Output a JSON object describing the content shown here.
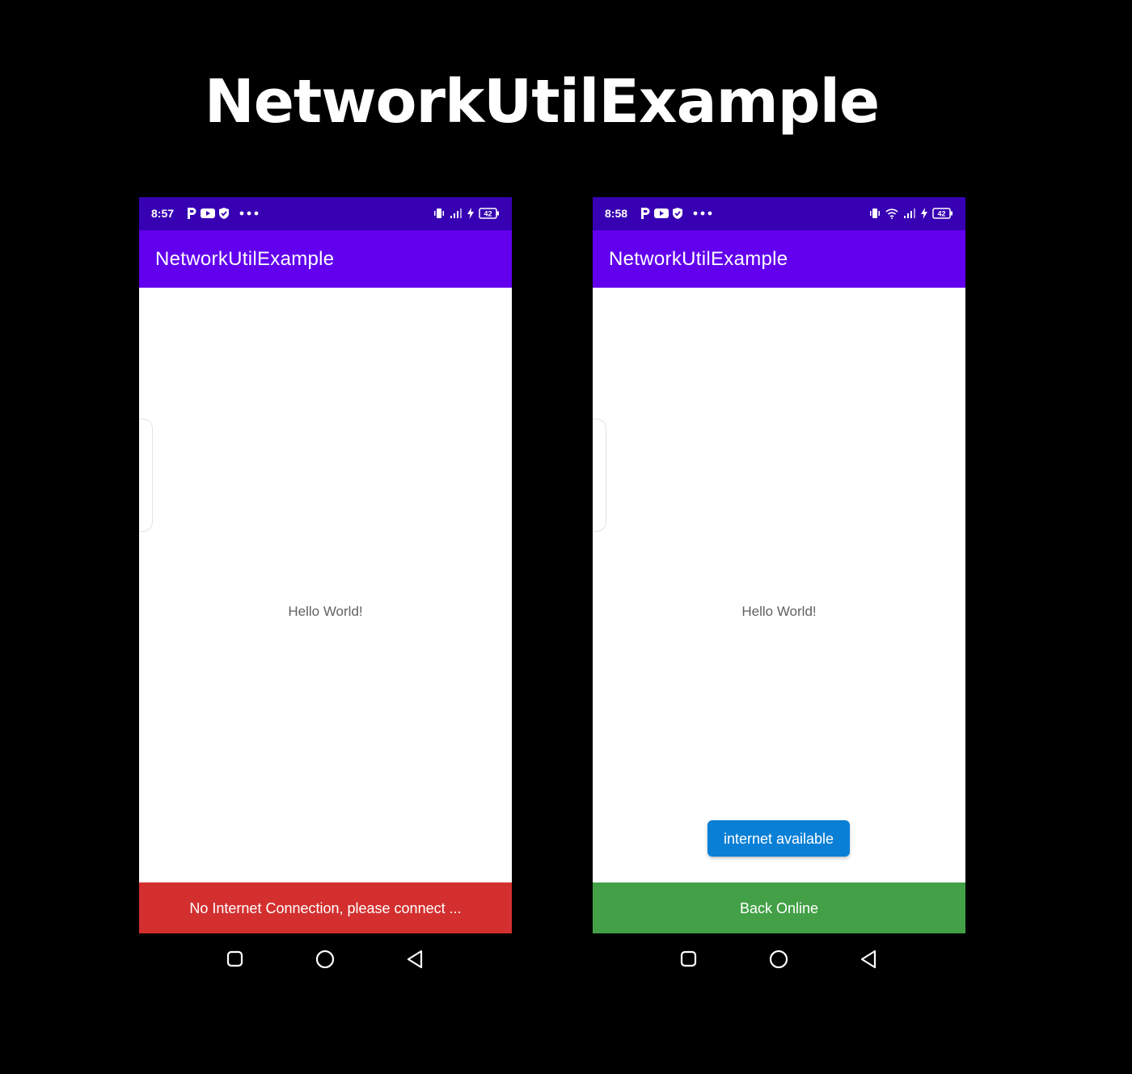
{
  "page": {
    "heading": "NetworkUtilExample"
  },
  "colors": {
    "status_bar": "#3700b3",
    "app_bar": "#6200ee",
    "offline_snackbar": "#d32f2f",
    "online_snackbar": "#43a047",
    "toast": "#0a7fd6",
    "background": "#000000"
  },
  "screens": [
    {
      "status": {
        "time": "8:57",
        "left_icons": [
          "p-icon",
          "youtube-icon",
          "shield-icon",
          "more-dots-icon"
        ],
        "right_icons": [
          "vibrate-icon",
          "signal-icon",
          "charging-icon",
          "battery-icon"
        ],
        "battery": "42"
      },
      "app_title": "NetworkUtilExample",
      "body_text": "Hello World!",
      "snackbar": "No Internet Connection, please connect ..."
    },
    {
      "status": {
        "time": "8:58",
        "left_icons": [
          "p-icon",
          "youtube-icon",
          "shield-icon",
          "more-dots-icon"
        ],
        "right_icons": [
          "vibrate-icon",
          "wifi-icon",
          "signal-icon",
          "charging-icon",
          "battery-icon"
        ],
        "battery": "42"
      },
      "app_title": "NetworkUtilExample",
      "body_text": "Hello World!",
      "toast": "internet available",
      "snackbar": "Back Online"
    }
  ],
  "nav": {
    "buttons": [
      "recents-square-icon",
      "home-circle-icon",
      "back-triangle-icon"
    ]
  }
}
